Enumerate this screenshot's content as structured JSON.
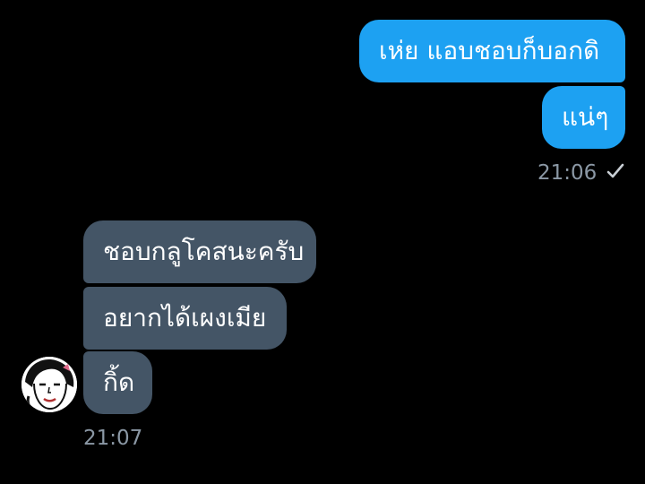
{
  "messages": {
    "sent": [
      {
        "text": "เห่ย  แอบชอบก็บอกดิ"
      },
      {
        "text": "แน่ๆ"
      }
    ],
    "sent_time": "21:06",
    "sent_status_icon": "check-icon",
    "received": [
      {
        "text": "ชอบกลูโคสนะครับ"
      },
      {
        "text": "อยากได้เผงเมีย"
      },
      {
        "text": "กิ้ด"
      }
    ],
    "received_time": "21:07",
    "avatar_icon": "contact-avatar"
  },
  "colors": {
    "background": "#000000",
    "sent_bubble": "#1da1f2",
    "received_bubble": "#445566",
    "timestamp": "#8b98a5"
  }
}
